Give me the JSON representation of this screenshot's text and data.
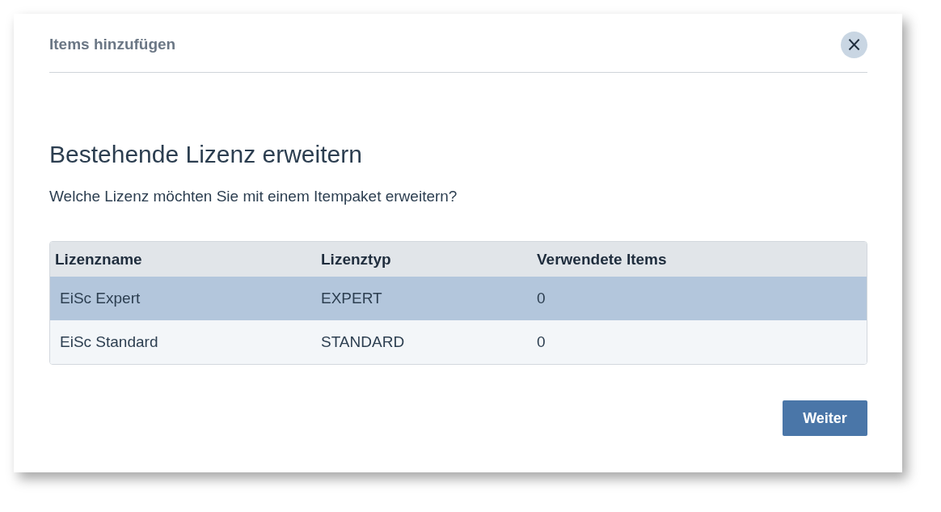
{
  "dialog": {
    "title": "Items hinzufügen",
    "close_label": "×"
  },
  "heading": "Bestehende Lizenz erweitern",
  "question": "Welche Lizenz möchten Sie mit einem Itempaket erweitern?",
  "table": {
    "columns": [
      "Lizenzname",
      "Lizenztyp",
      "Verwendete Items"
    ],
    "rows": [
      {
        "cells": [
          "EiSc Expert",
          "EXPERT",
          "0"
        ],
        "selected": true
      },
      {
        "cells": [
          "EiSc Standard",
          "STANDARD",
          "0"
        ],
        "selected": false
      }
    ]
  },
  "buttons": [
    "Weiter"
  ]
}
